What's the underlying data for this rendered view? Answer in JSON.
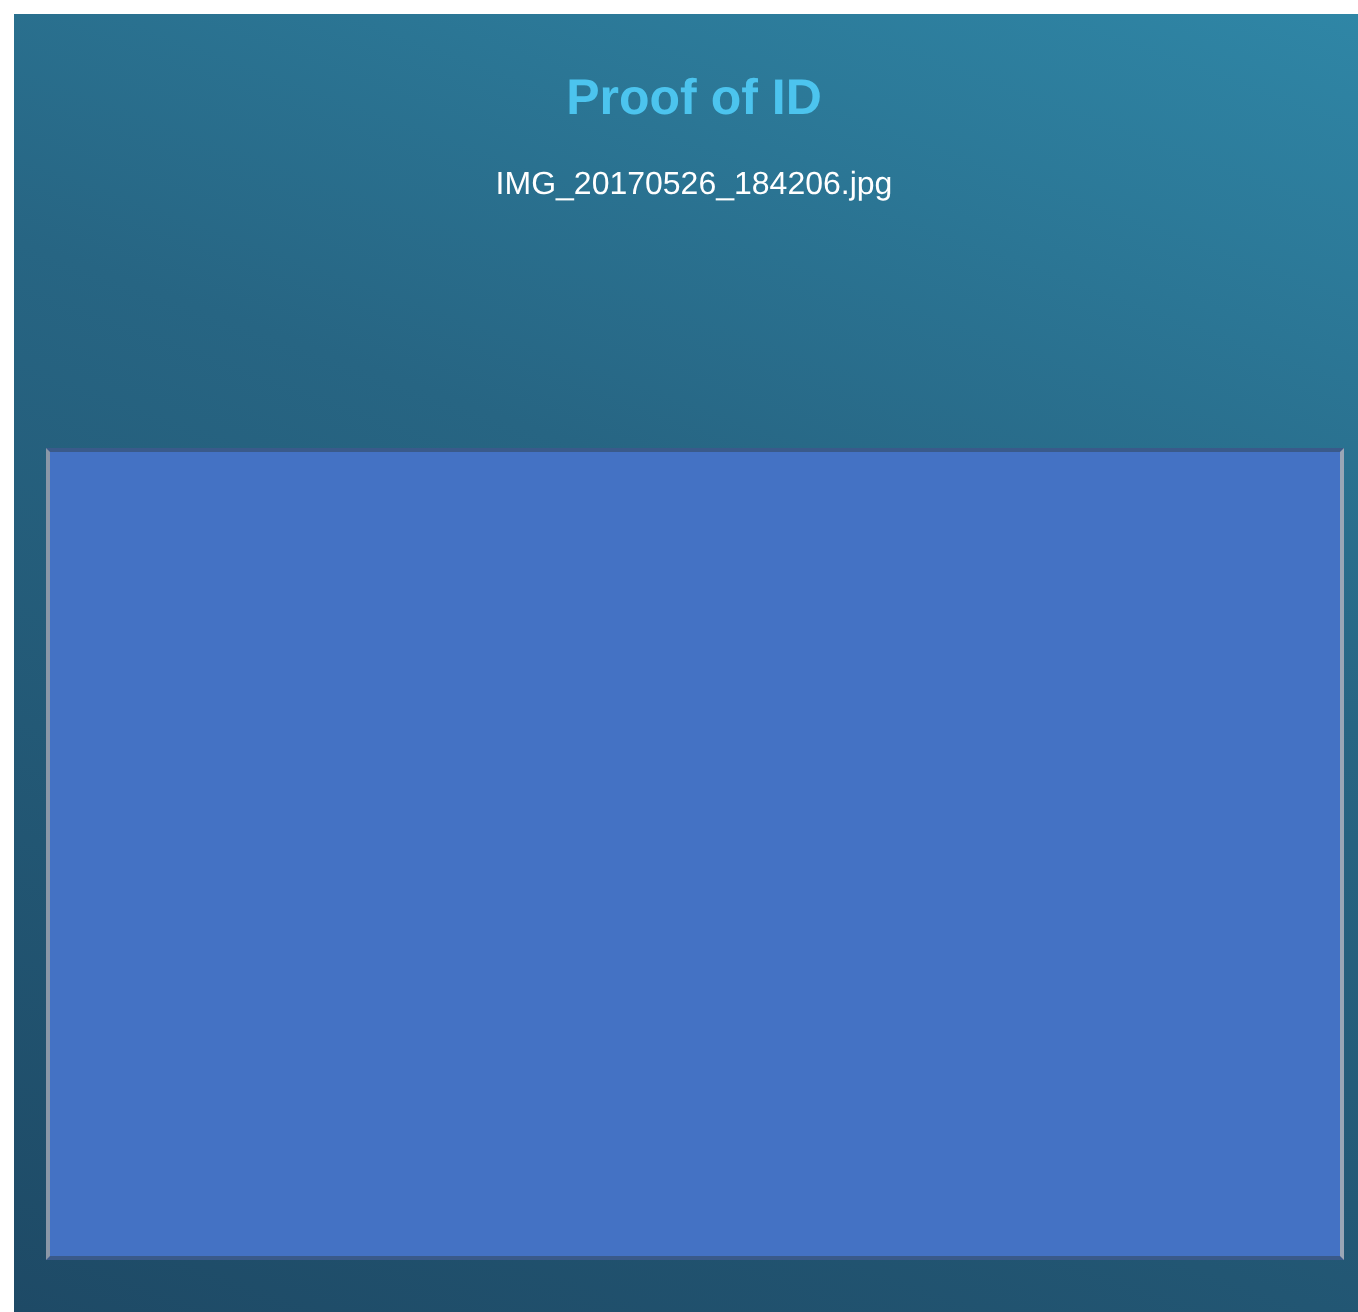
{
  "title": "Proof of ID",
  "filename": "IMG_20170526_184206.jpg"
}
